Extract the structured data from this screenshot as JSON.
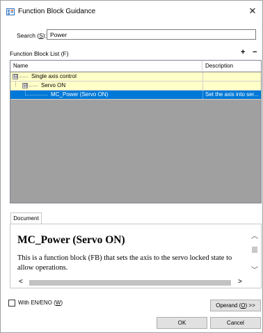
{
  "window": {
    "title": "Function Block Guidance",
    "close_glyph": "✕",
    "title_icon": "function-block-icon"
  },
  "search": {
    "label_pre": "Search (",
    "label_key": "S",
    "label_post": "):",
    "value": "Power"
  },
  "function_block_list": {
    "header": "Function Block List (F)",
    "add_glyph": "+",
    "remove_glyph": "−",
    "columns": {
      "name": "Name",
      "description": "Description"
    },
    "rows": [
      {
        "name": "Single axis control",
        "description": "",
        "expander": "⊟",
        "selected": false
      },
      {
        "name": "Servo ON",
        "description": "",
        "expander": "⊟",
        "selected": false
      },
      {
        "name": "MC_Power (Servo ON)",
        "description": "Set the axis into ser...",
        "expander": "",
        "selected": true
      }
    ]
  },
  "document": {
    "tab_label": "Document",
    "title": "MC_Power (Servo ON)",
    "body": "This is a function block (FB) that sets the axis to the servo locked state to allow operations."
  },
  "options": {
    "en_eno_pre": "With EN/ENO (",
    "en_eno_key": "W",
    "en_eno_post": ")",
    "en_eno_checked": false
  },
  "buttons": {
    "operand_pre": "Operand (",
    "operand_key": "O",
    "operand_post": ") >>",
    "ok": "OK",
    "cancel": "Cancel"
  },
  "colors": {
    "selection": "#0078d7",
    "row_highlight": "#ffffc8",
    "list_background": "#a0a0a0"
  }
}
